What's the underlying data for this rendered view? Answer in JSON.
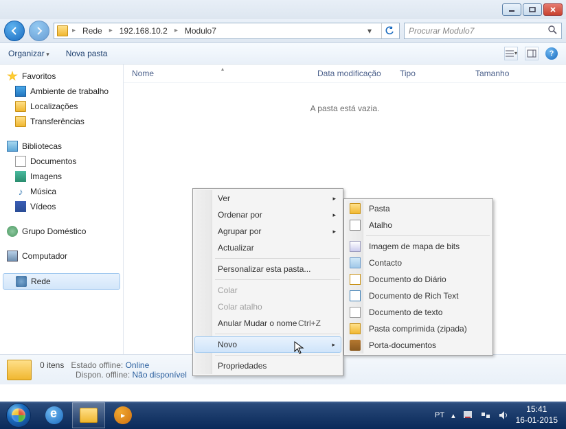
{
  "breadcrumb": {
    "root": "Rede",
    "host": "192.168.10.2",
    "folder": "Modulo7"
  },
  "search": {
    "placeholder": "Procurar Modulo7"
  },
  "toolbar": {
    "organize": "Organizar",
    "newfolder": "Nova pasta"
  },
  "columns": {
    "name": "Nome",
    "date": "Data modificação",
    "type": "Tipo",
    "size": "Tamanho"
  },
  "content": {
    "empty": "A pasta está vazia."
  },
  "sidebar": {
    "favorites": "Favoritos",
    "desktop": "Ambiente de trabalho",
    "places": "Localizações",
    "downloads": "Transferências",
    "libraries": "Bibliotecas",
    "documents": "Documentos",
    "pictures": "Imagens",
    "music": "Música",
    "videos": "Vídeos",
    "homegroup": "Grupo Doméstico",
    "computer": "Computador",
    "network": "Rede"
  },
  "ctx1": {
    "view": "Ver",
    "sort": "Ordenar por",
    "group": "Agrupar por",
    "refresh": "Actualizar",
    "customize": "Personalizar esta pasta...",
    "paste": "Colar",
    "pasteShortcut": "Colar atalho",
    "undo": "Anular Mudar o nome",
    "undoKey": "Ctrl+Z",
    "new": "Novo",
    "properties": "Propriedades"
  },
  "ctx2": {
    "folder": "Pasta",
    "shortcut": "Atalho",
    "bitmap": "Imagem de mapa de bits",
    "contact": "Contacto",
    "journal": "Documento do Diário",
    "rtf": "Documento de Rich Text",
    "txt": "Documento de texto",
    "zip": "Pasta comprimida (zipada)",
    "briefcase": "Porta-documentos"
  },
  "status": {
    "items": "0 itens",
    "offlineLabel": "Estado offline:",
    "offlineValue": "Online",
    "availLabel": "Dispon. offline:",
    "availValue": "Não disponível"
  },
  "tray": {
    "lang": "PT",
    "time": "15:41",
    "date": "16-01-2015"
  }
}
